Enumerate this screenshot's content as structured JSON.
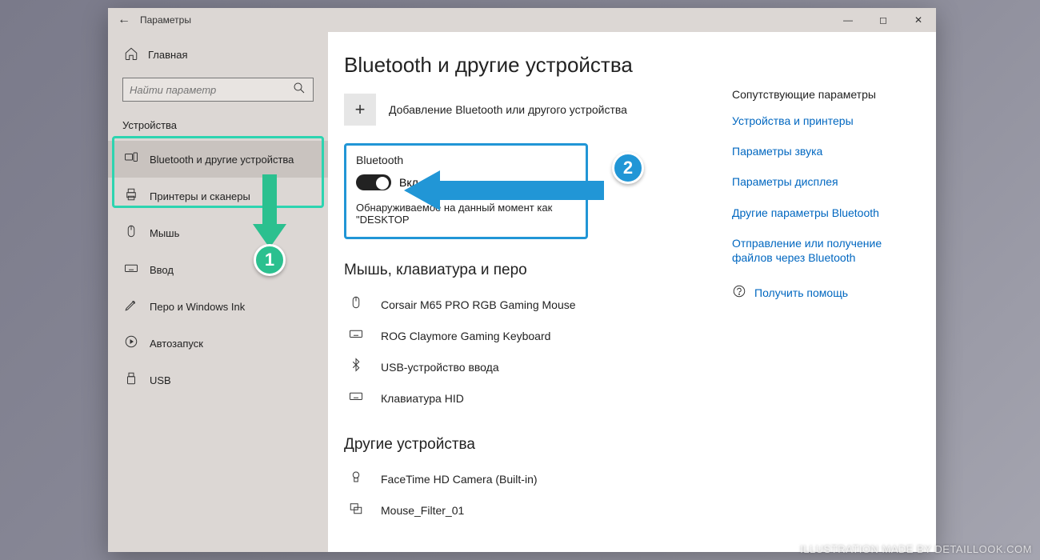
{
  "titlebar": {
    "title": "Параметры"
  },
  "sidebar": {
    "home": "Главная",
    "search_placeholder": "Найти параметр",
    "category": "Устройства",
    "items": [
      {
        "label": "Bluetooth и другие устройства"
      },
      {
        "label": "Принтеры и сканеры"
      },
      {
        "label": "Мышь"
      },
      {
        "label": "Ввод"
      },
      {
        "label": "Перо и Windows Ink"
      },
      {
        "label": "Автозапуск"
      },
      {
        "label": "USB"
      }
    ]
  },
  "main": {
    "heading": "Bluetooth и другие устройства",
    "add_device": "Добавление Bluetooth или другого устройства",
    "bt_section_label": "Bluetooth",
    "bt_toggle": "Вкл.",
    "discoverable": "Обнаруживаемое на данный момент как \"DESKTOP",
    "section_mouse": "Мышь, клавиатура и перо",
    "section_other": "Другие устройства",
    "devices_mkp": [
      "Corsair M65 PRO RGB Gaming Mouse",
      "ROG Claymore Gaming Keyboard",
      "USB-устройство ввода",
      "Клавиатура HID"
    ],
    "devices_other": [
      "FaceTime HD Camera (Built-in)",
      "Mouse_Filter_01"
    ]
  },
  "related": {
    "heading": "Сопутствующие параметры",
    "links": [
      "Устройства и принтеры",
      "Параметры звука",
      "Параметры дисплея",
      "Другие параметры Bluetooth",
      "Отправление или получение файлов через Bluetooth"
    ],
    "help": "Получить помощь"
  },
  "annotations": {
    "badge1": "1",
    "badge2": "2"
  },
  "watermark": "ILLUSTRATION MADE BY DETAILLOOK.COM"
}
